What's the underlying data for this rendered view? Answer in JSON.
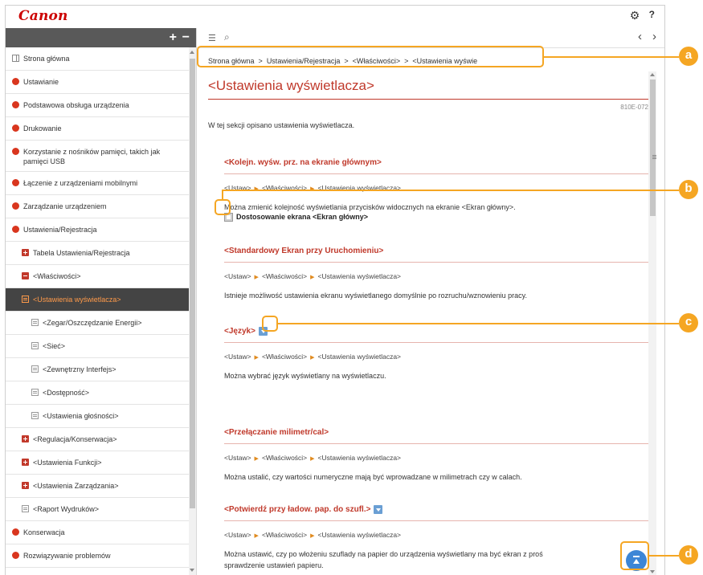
{
  "app": {
    "logo": "Canon",
    "gear_icon": "gear-icon",
    "help_label": "?"
  },
  "sidebar": {
    "expand_all": "+",
    "collapse_all": "−",
    "items": [
      {
        "label": "Strona główna",
        "level": 0,
        "icon": "book-icon"
      },
      {
        "label": "Ustawianie",
        "level": 0,
        "icon": "bullet-icon"
      },
      {
        "label": "Podstawowa obsługa urządzenia",
        "level": 0,
        "icon": "bullet-icon"
      },
      {
        "label": "Drukowanie",
        "level": 0,
        "icon": "bullet-icon"
      },
      {
        "label": "Korzystanie z nośników pamięci, takich jak pamięci USB",
        "level": 0,
        "icon": "bullet-icon"
      },
      {
        "label": "Łączenie z urządzeniami mobilnymi",
        "level": 0,
        "icon": "bullet-icon"
      },
      {
        "label": "Zarządzanie urządzeniem",
        "level": 0,
        "icon": "bullet-icon"
      },
      {
        "label": "Ustawienia/Rejestracja",
        "level": 0,
        "icon": "bullet-icon"
      },
      {
        "label": "Tabela Ustawienia/Rejestracja",
        "level": 1,
        "icon": "plus-icon"
      },
      {
        "label": "<Właściwości>",
        "level": 1,
        "icon": "minus-icon"
      },
      {
        "label": "<Ustawienia wyświetlacza>",
        "level": 1,
        "icon": "page-icon",
        "active": true
      },
      {
        "label": "<Zegar/Oszczędzanie Energii>",
        "level": 2,
        "icon": "page-icon"
      },
      {
        "label": "<Sieć>",
        "level": 2,
        "icon": "page-icon"
      },
      {
        "label": "<Zewnętrzny Interfejs>",
        "level": 2,
        "icon": "page-icon"
      },
      {
        "label": "<Dostępność>",
        "level": 2,
        "icon": "page-icon"
      },
      {
        "label": "<Ustawienia głośności>",
        "level": 2,
        "icon": "page-icon"
      },
      {
        "label": "<Regulacja/Konserwacja>",
        "level": 1,
        "icon": "plus-icon"
      },
      {
        "label": "<Ustawienia Funkcji>",
        "level": 1,
        "icon": "plus-icon"
      },
      {
        "label": "<Ustawienia Zarządzania>",
        "level": 1,
        "icon": "plus-icon"
      },
      {
        "label": "<Raport Wydruków>",
        "level": 1,
        "icon": "page-icon"
      },
      {
        "label": "Konserwacja",
        "level": 0,
        "icon": "bullet-icon"
      },
      {
        "label": "Rozwiązywanie problemów",
        "level": 0,
        "icon": "bullet-icon"
      }
    ]
  },
  "toolbar": {
    "prev_label": "‹",
    "next_label": "›"
  },
  "breadcrumb": [
    "Strona główna",
    "Ustawienia/Rejestracja",
    "<Właściwości>",
    "<Ustawienia wyświe"
  ],
  "breadcrumb_sep": ">",
  "page": {
    "title": "<Ustawienia wyświetlacza>",
    "doc_code": "810E-072",
    "intro": "W tej sekcji opisano ustawienia wyświetlacza.",
    "path": [
      "<Ustaw>",
      "<Właściwości>",
      "<Ustawienia wyświetlacza>"
    ],
    "sections": [
      {
        "title": "<Kolejn. wyśw. prz. na ekranie głównym>",
        "text": "Można zmienić kolejność wyświetlania przycisków widocznych na ekranie <Ekran główny>.",
        "link": "Dostosowanie ekrana <Ekran główny>"
      },
      {
        "title": "<Standardowy Ekran przy Uruchomieniu>",
        "text": "Istnieje możliwość ustawienia ekranu wyświetlanego domyślnie po rozruchu/wznowieniu pracy."
      },
      {
        "title": "<Język>",
        "text": "Można wybrać język wyświetlany na wyświetlaczu.",
        "expand": true
      },
      {
        "title": "<Przełączanie milimetr/cal>",
        "text": "Można ustalić, czy wartości numeryczne mają być wprowadzane w milimetrach czy w calach."
      },
      {
        "title": "<Potwierdź przy ładow. pap. do szufl.>",
        "text": "Można ustawić, czy po włożeniu szuflady na papier do urządzenia wyświetlany ma być ekran z proś",
        "text2": "sprawdzenie ustawień papieru.",
        "expand": true
      }
    ]
  },
  "callouts": [
    "a",
    "b",
    "c",
    "d"
  ],
  "colors": {
    "accent": "#c0392b",
    "callout": "#f5a623",
    "logo": "#cc0000",
    "top_button": "#3d86d6"
  }
}
